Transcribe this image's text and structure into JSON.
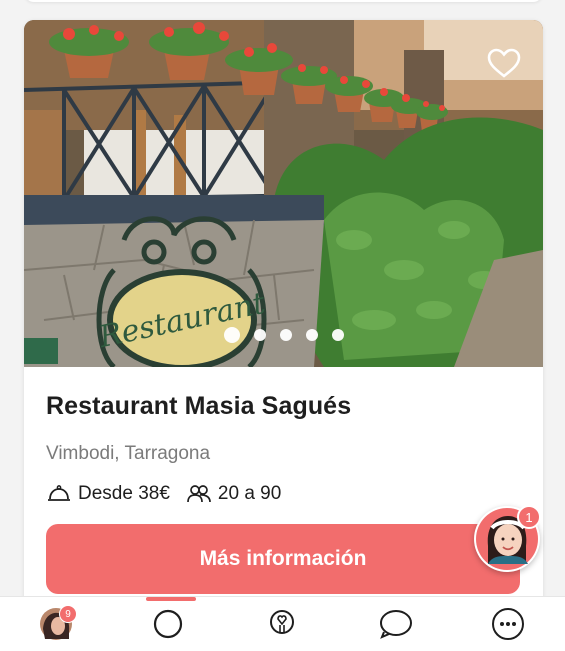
{
  "listing": {
    "title": "Restaurant Masia Sagués",
    "location": "Vimbodi, Tarragona",
    "price_text": "Desde 38€",
    "guests_text": "20 a 90",
    "cta_label": "Más información",
    "favorite_icon": "heart-outline-icon",
    "carousel": {
      "total_slides": 5,
      "active_index": 0
    },
    "sign_text": "Restaurant"
  },
  "assistant": {
    "badge_count": "1",
    "icon": "assistant-avatar-icon"
  },
  "bottom_nav": {
    "items": [
      {
        "name": "profile",
        "icon": "profile-avatar-icon",
        "badge": "9"
      },
      {
        "name": "search",
        "icon": "search-circle-icon",
        "active": true
      },
      {
        "name": "ideas",
        "icon": "lightbulb-icon"
      },
      {
        "name": "chat",
        "icon": "chat-bubble-icon"
      },
      {
        "name": "more",
        "icon": "more-dots-icon"
      }
    ]
  },
  "colors": {
    "accent": "#f26d6d",
    "title": "#1e1e1e",
    "muted": "#7b7b7b"
  }
}
